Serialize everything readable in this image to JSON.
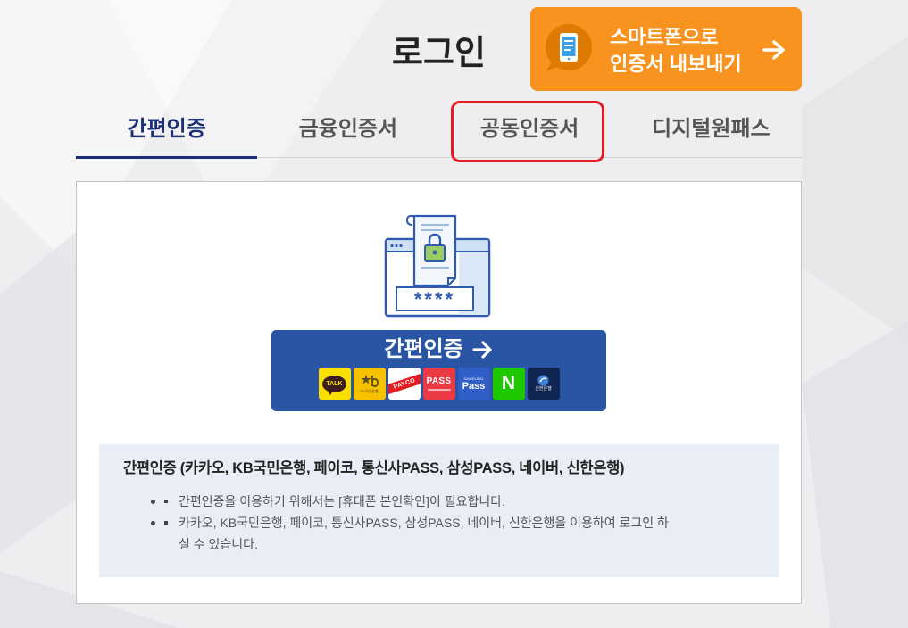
{
  "page": {
    "title": "로그인"
  },
  "export_button": {
    "icon": "smartphone-icon",
    "arrow_icon": "arrow-right-icon",
    "line1": "스마트폰으로",
    "line2": "인증서 내보내기"
  },
  "tabs": [
    {
      "label": "간편인증",
      "active": true
    },
    {
      "label": "금융인증서",
      "active": false
    },
    {
      "label": "공동인증서",
      "active": false,
      "highlighted": true
    },
    {
      "label": "디지털원패스",
      "active": false
    }
  ],
  "login_panel": {
    "illustration": "certificate-lock-icon",
    "password_mask": "****",
    "button_label": "간편인증",
    "button_icon": "arrow-right-icon",
    "providers": [
      {
        "icon": "kakao-logo",
        "text": "TALK"
      },
      {
        "icon": "kb-logo",
        "text": "KB국민은행"
      },
      {
        "icon": "payco-logo",
        "text": "PAYCO"
      },
      {
        "icon": "pass-logo",
        "text": "PASS"
      },
      {
        "icon": "samsung-pass-logo",
        "brand": "SAMSUNG",
        "text": "Pass"
      },
      {
        "icon": "naver-logo",
        "text": "N"
      },
      {
        "icon": "shinhan-logo",
        "text": "신한은행"
      }
    ]
  },
  "info": {
    "title": "간편인증 (카카오, KB국민은행, 페이코, 통신사PASS, 삼성PASS, 네이버, 신한은행)",
    "items": [
      "간편인증을 이용하기 위해서는 [휴대폰 본인확인]이 필요합니다.",
      "카카오, KB국민은행, 페이코, 통신사PASS, 삼성PASS, 네이버, 신한은행을 이용하여 로그인 하실 수 있습니다."
    ]
  },
  "colors": {
    "accent_navy": "#1b2f78",
    "export_orange": "#f7931e",
    "button_blue": "#2a55a5",
    "highlight_red": "#e31b23",
    "info_bg": "#e9eef6"
  }
}
